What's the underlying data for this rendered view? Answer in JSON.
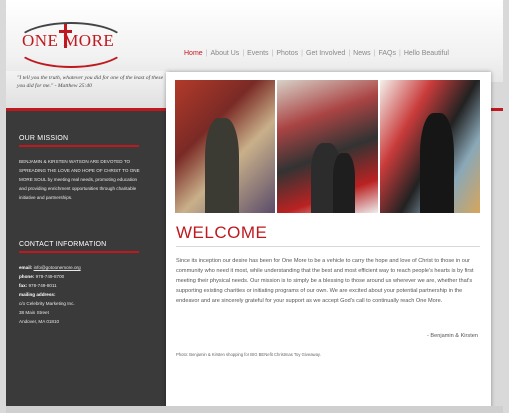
{
  "logo": {
    "text": "ONE MORE"
  },
  "nav": {
    "items": [
      "Home",
      "About Us",
      "Events",
      "Photos",
      "Get Involved",
      "News",
      "FAQs",
      "Hello Beautiful"
    ],
    "active": "Home"
  },
  "quote": "\"I tell you the truth, whatever you did for one of the least of these you did for me.\" - Matthew 25:40",
  "mission": {
    "heading": "OUR MISSION",
    "text": "BENJAMIN & KIRSTEN WATSON ARE DEVOTED TO SPREADING THE LOVE AND HOPE OF CHRIST TO ONE MORE SOUL by meeting real needs, promoting education and providing enrichment opportunities through charitable initiative and partnerships."
  },
  "contact": {
    "heading": "CONTACT INFORMATION",
    "email_label": "email:",
    "email": "info@gotoonemore.org",
    "phone_label": "phone:",
    "phone": "978-749-8700",
    "fax_label": "fax:",
    "fax": "978-749-8011",
    "mailing_label": "mailing address:",
    "address_line1": "c/o Celebrity Marketing Inc.",
    "address_line2": "38 Main Street",
    "address_line3": "Andover, MA 01810"
  },
  "main": {
    "title": "WELCOME",
    "body": "Since its inception our desire has been for One More to be a vehicle to carry the hope and love of Christ to those in our community who need it most, while understanding that the best and most efficient way to reach people's hearts is by first meeting their physical needs. Our mission is to simply be a blessing to those around us wherever we are, whether that's supporting existing charities or initiating programs of our own. We are excited about your potential partnership in the endeavor and are sincerely grateful for your support as we accept God's call to continually reach One More.",
    "signature": "- Benjamin & Kirsten",
    "caption": "Photo: Benjamin & Kirsten shopping for BIG BENefit Christmas Toy Giveaway."
  },
  "colors": {
    "accent": "#c0181f",
    "sidebar": "#3a3a3a"
  }
}
